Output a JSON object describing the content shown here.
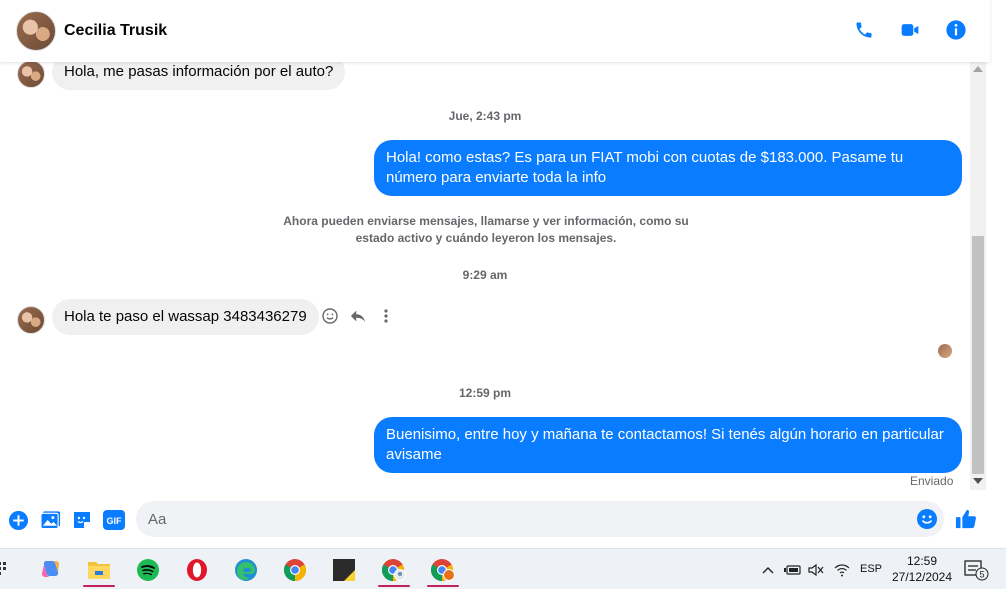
{
  "header": {
    "contact_name": "Cecilia Trusik",
    "icons": [
      "phone-icon",
      "video-icon",
      "info-icon"
    ]
  },
  "messages": {
    "incoming_1": "Hola, me pasas información por el auto?",
    "ts_1": "Jue, 2:43 pm",
    "outgoing_1": "Hola! como estas? Es para un FIAT mobi con cuotas de $183.000. Pasame tu número para enviarte toda la info",
    "notice": "Ahora pueden enviarse mensajes, llamarse y ver información, como su estado activo y cuándo leyeron los mensajes.",
    "ts_2": "9:29 am",
    "incoming_2": "Hola te paso el wassap 3483436279",
    "ts_3": "12:59 pm",
    "outgoing_2": "Buenisimo, entre hoy y mañana te contactamos! Si tenés algún horario en particular avisame",
    "status": "Enviado"
  },
  "composer": {
    "placeholder": "Aa",
    "icons": [
      "plus-icon",
      "image-icon",
      "sticker-icon",
      "gif-icon",
      "emoji-icon",
      "like-icon"
    ],
    "gif_label": "GIF"
  },
  "taskbar": {
    "apps": [
      "copilot",
      "file-explorer",
      "spotify",
      "opera",
      "edge",
      "chrome",
      "sticky-notes",
      "chrome-profile-1",
      "chrome-profile-2"
    ],
    "lang": "ESP",
    "time": "12:59",
    "date": "27/12/2024",
    "notification_count": "5"
  },
  "colors": {
    "accent": "#0a7cff",
    "incoming_bubble": "#f0f0f0",
    "muted_text": "#65676b"
  }
}
